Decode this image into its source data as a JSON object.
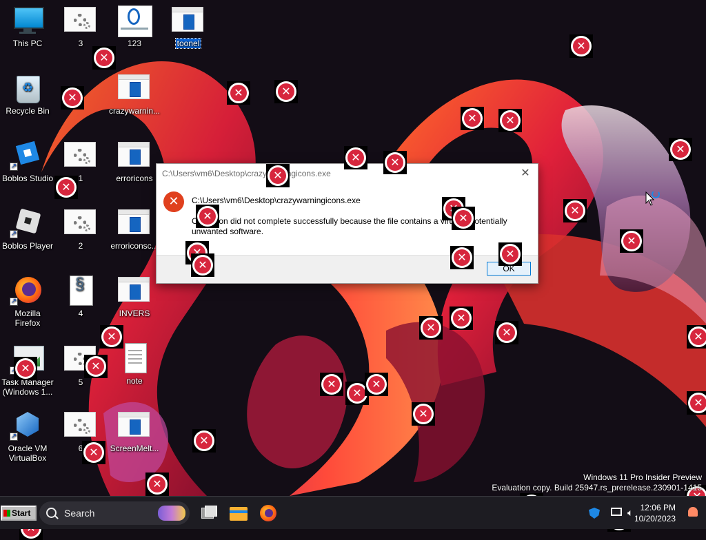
{
  "desktop": {
    "icons": [
      {
        "label": "This PC"
      },
      {
        "label": "Recycle Bin"
      },
      {
        "label": "Boblos Studio"
      },
      {
        "label": "Boblos Player"
      },
      {
        "label": "Mozilla Firefox"
      },
      {
        "label": "Task Manager (Windows 1..."
      },
      {
        "label": "Oracle VM VirtualBox"
      },
      {
        "label": "3"
      },
      {
        "label": "1"
      },
      {
        "label": "2"
      },
      {
        "label": "4"
      },
      {
        "label": "5"
      },
      {
        "label": "6"
      },
      {
        "label": "123"
      },
      {
        "label": "crazywarnin..."
      },
      {
        "label": "erroricons"
      },
      {
        "label": "erroriconsc..."
      },
      {
        "label": "INVERS"
      },
      {
        "label": "note"
      },
      {
        "label": "ScreenMelt..."
      },
      {
        "label": "toonel"
      }
    ]
  },
  "dialog": {
    "title": "C:\\Users\\vm6\\Desktop\\crazywarningicons.exe",
    "path": "C:\\Users\\vm6\\Desktop\\crazywarningicons.exe",
    "message": "Operation did not complete successfully because the file contains a virus or potentially unwanted software.",
    "ok_label": "OK",
    "close_glyph": "✕"
  },
  "watermark": {
    "line1": "Windows 11 Pro Insider Preview",
    "line2": "Evaluation copy. Build 25947.rs_prerelease.230901-1415"
  },
  "taskbar": {
    "start_label": "Start",
    "search_placeholder": "Search",
    "clock_time": "12:06 PM",
    "clock_date": "10/20/2023"
  },
  "colors": {
    "error_red": "#d7263d",
    "dialog_icon": "#e0401e",
    "selection_blue": "#0a64d8"
  }
}
